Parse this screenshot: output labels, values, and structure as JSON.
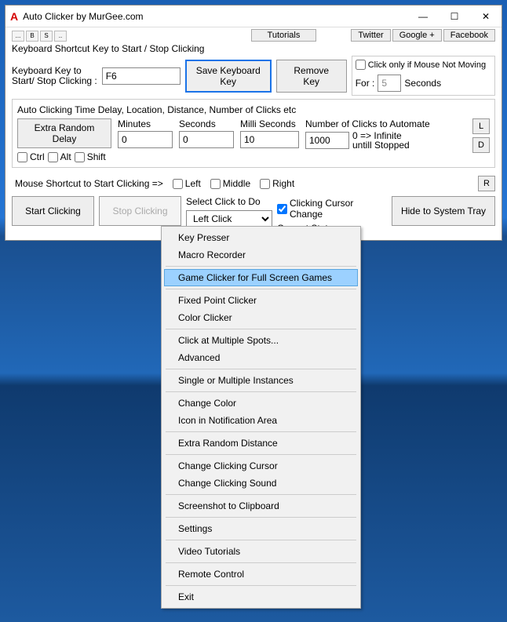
{
  "window": {
    "title": "Auto Clicker by MurGee.com",
    "icon_letter": "A"
  },
  "top_links": {
    "tutorials": "Tutorials",
    "twitter": "Twitter",
    "google": "Google +",
    "facebook": "Facebook"
  },
  "tiny_toolbar": {
    "a": "...",
    "b": "B",
    "c": "S",
    "d": ".."
  },
  "shortcut": {
    "heading": "Keyboard Shortcut Key to Start / Stop Clicking",
    "label_line1": "Keyboard Key to",
    "label_line2": "Start/ Stop Clicking :",
    "value": "F6",
    "save_btn": "Save Keyboard Key",
    "remove_btn": "Remove Key",
    "click_only_if": "Click only if Mouse Not Moving",
    "for_label": "For :",
    "for_value": "5",
    "seconds_label": "Seconds"
  },
  "timing": {
    "heading": "Auto Clicking Time Delay, Location, Distance, Number of Clicks etc",
    "extra_delay_btn": "Extra Random Delay",
    "ctrl": "Ctrl",
    "alt": "Alt",
    "shift": "Shift",
    "minutes_label": "Minutes",
    "minutes": "0",
    "seconds_label": "Seconds",
    "seconds": "0",
    "milli_label": "Milli Seconds",
    "milli": "10",
    "clicks_label": "Number of Clicks to Automate",
    "clicks": "1000",
    "hint_line1": "0 => Infinite",
    "hint_line2": "untill Stopped",
    "L": "L",
    "D": "D"
  },
  "mouse": {
    "label": "Mouse Shortcut to Start Clicking =>",
    "left": "Left",
    "middle": "Middle",
    "right": "Right",
    "R": "R"
  },
  "bottom": {
    "start": "Start Clicking",
    "stop": "Stop Clicking",
    "select_label": "Select Click to Do",
    "select_value": "Left Click",
    "cursor_change": "Clicking Cursor Change",
    "current_status": "Current Status",
    "hide": "Hide to System Tray"
  },
  "menu": {
    "items": [
      "Key Presser",
      "Macro Recorder",
      "-",
      "Game Clicker for Full Screen Games",
      "-",
      "Fixed Point Clicker",
      "Color Clicker",
      "-",
      "Click at Multiple Spots...",
      "Advanced",
      "-",
      "Single or Multiple Instances",
      "-",
      "Change Color",
      "Icon in Notification Area",
      "-",
      "Extra Random Distance",
      "-",
      "Change Clicking Cursor",
      "Change Clicking Sound",
      "-",
      "Screenshot to Clipboard",
      "-",
      "Settings",
      "-",
      "Video Tutorials",
      "-",
      "Remote Control",
      "-",
      "Exit"
    ],
    "highlighted_index": 3
  }
}
